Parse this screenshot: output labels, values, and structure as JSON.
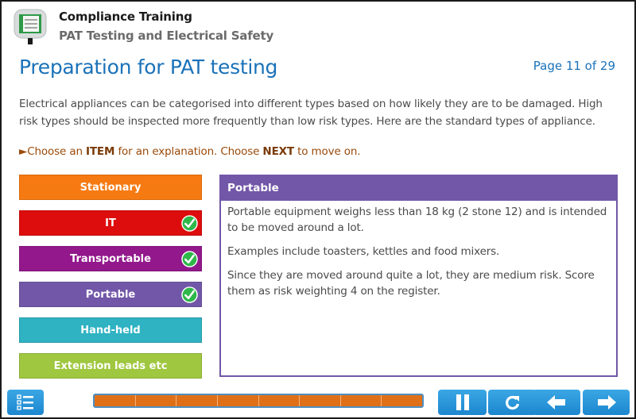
{
  "header": {
    "course_title": "Compliance Training",
    "course_subtitle": "PAT Testing and Electrical Safety",
    "logo_icon": "pat-tester-icon"
  },
  "page": {
    "title": "Preparation for PAT testing",
    "page_number": "Page 11 of 29",
    "current_page": 11,
    "total_pages": 29
  },
  "intro": "Electrical appliances can be categorised into different types based on how likely they are to be damaged. High risk types should be inspected more frequently than low risk types. Here are the standard types of appliance.",
  "instruction": {
    "arrow": "►",
    "part1": "Choose an ",
    "item_word": "ITEM",
    "part2": " for an explanation. Choose ",
    "next_word": "NEXT",
    "part3": " to move on."
  },
  "items": [
    {
      "label": "Stationary",
      "color": "#f67a12",
      "visited": false
    },
    {
      "label": "IT",
      "color": "#dd0d0d",
      "visited": true
    },
    {
      "label": "Transportable",
      "color": "#92188b",
      "visited": true
    },
    {
      "label": "Portable",
      "color": "#7257a8",
      "visited": true
    },
    {
      "label": "Hand-held",
      "color": "#2fb2c2",
      "visited": false
    },
    {
      "label": "Extension leads etc",
      "color": "#9fc73f",
      "visited": false
    }
  ],
  "panel": {
    "title": "Portable",
    "paragraphs": [
      "Portable equipment weighs less than 18 kg (2 stone 12) and is intended to be moved around a lot.",
      "Examples include toasters, kettles and food mixers.",
      "Since they are moved around quite a lot, they are medium risk. Score them as risk weighting 4 on the register."
    ]
  },
  "footer": {
    "menu_icon": "menu-list-icon",
    "progress": {
      "segments_total": 8,
      "segments_complete": 8
    },
    "buttons": [
      {
        "name": "pause",
        "icon": "pause-icon"
      },
      {
        "name": "replay",
        "icon": "replay-icon"
      },
      {
        "name": "back",
        "icon": "arrow-left-icon"
      },
      {
        "name": "next",
        "icon": "arrow-right-icon"
      }
    ]
  },
  "colors": {
    "title_blue": "#1a72b9",
    "instruction_brown": "#9a4a0a",
    "panel_purple": "#7257a8",
    "button_blue": "#1d87cf",
    "progress_orange": "#e07018",
    "check_green": "#2eb84a"
  }
}
